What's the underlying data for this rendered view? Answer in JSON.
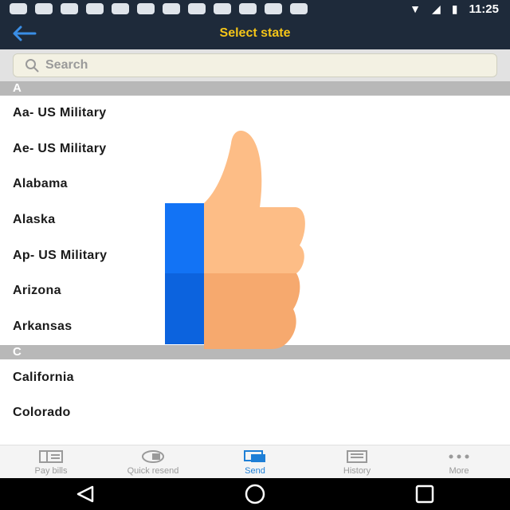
{
  "status_bar": {
    "time": "11:25",
    "notification_icons": [
      "notification-icon",
      "cat-icon",
      "loop-icon",
      "cat-icon",
      "loop-icon",
      "loop-icon",
      "cat-icon",
      "chat-icon",
      "mail-icon",
      "pinterest-icon",
      "cluster-icon",
      "e-icon"
    ]
  },
  "header": {
    "title": "Select state",
    "accent_color": "#f5c518",
    "bar_color": "#1e2a3a"
  },
  "search": {
    "placeholder": "Search",
    "value": ""
  },
  "sections": [
    {
      "letter": "A",
      "items": [
        "Aa-  US Military",
        "Ae-  US Military",
        "Alabama",
        "Alaska",
        "Ap-  US Military",
        "Arizona",
        "Arkansas"
      ]
    },
    {
      "letter": "C",
      "items": [
        "California",
        "Colorado"
      ]
    }
  ],
  "bottom_nav": {
    "items": [
      {
        "label": "Pay bills",
        "icon": "bills-icon"
      },
      {
        "label": "Quick resend",
        "icon": "resend-icon"
      },
      {
        "label": "Send",
        "icon": "send-icon",
        "active": true
      },
      {
        "label": "History",
        "icon": "history-icon"
      },
      {
        "label": "More",
        "icon": "more-icon"
      }
    ],
    "active_color": "#1e7fd6"
  }
}
